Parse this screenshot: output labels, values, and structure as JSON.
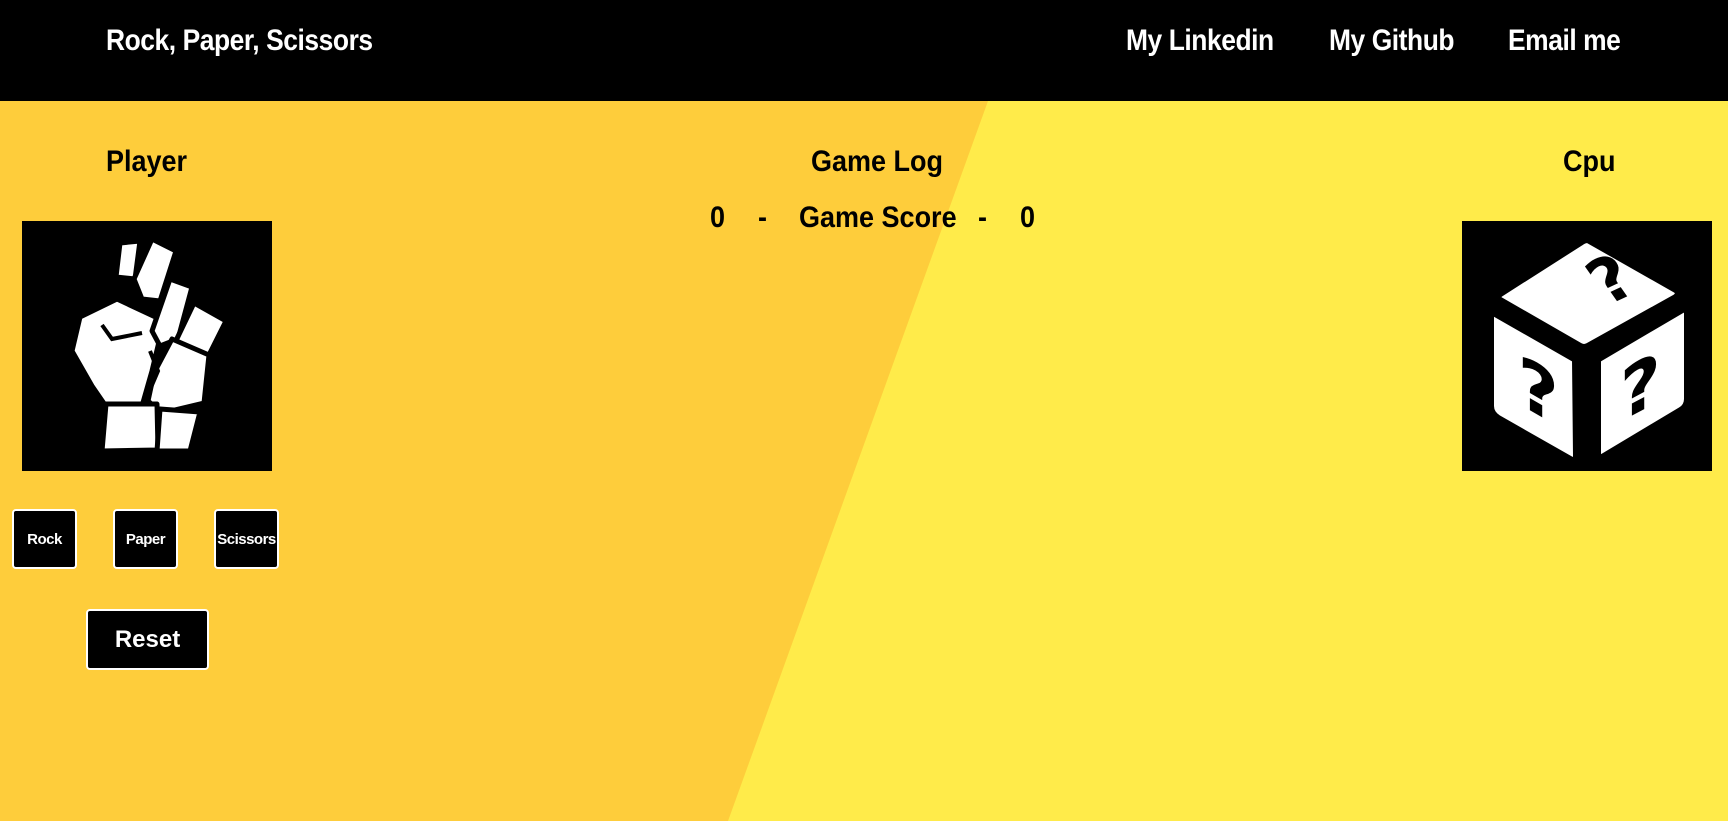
{
  "nav": {
    "title": "Rock, Paper, Scissors",
    "links": [
      "My Linkedin",
      "My Github",
      "Email me"
    ]
  },
  "player": {
    "heading": "Player",
    "icon": "raised-fist-icon"
  },
  "game_log": {
    "heading": "Game Log",
    "player_score": "0",
    "separator": "-",
    "score_label": "Game Score",
    "cpu_score": "0"
  },
  "cpu": {
    "heading": "Cpu",
    "icon": "mystery-dice-icon"
  },
  "choices": [
    "Rock",
    "Paper",
    "Scissors"
  ],
  "reset_label": "Reset",
  "colors": {
    "navbar": "#000000",
    "bg_left": "#fecd3b",
    "bg_right": "#ffeb4a",
    "card": "#000000",
    "text_light": "#ffffff"
  }
}
